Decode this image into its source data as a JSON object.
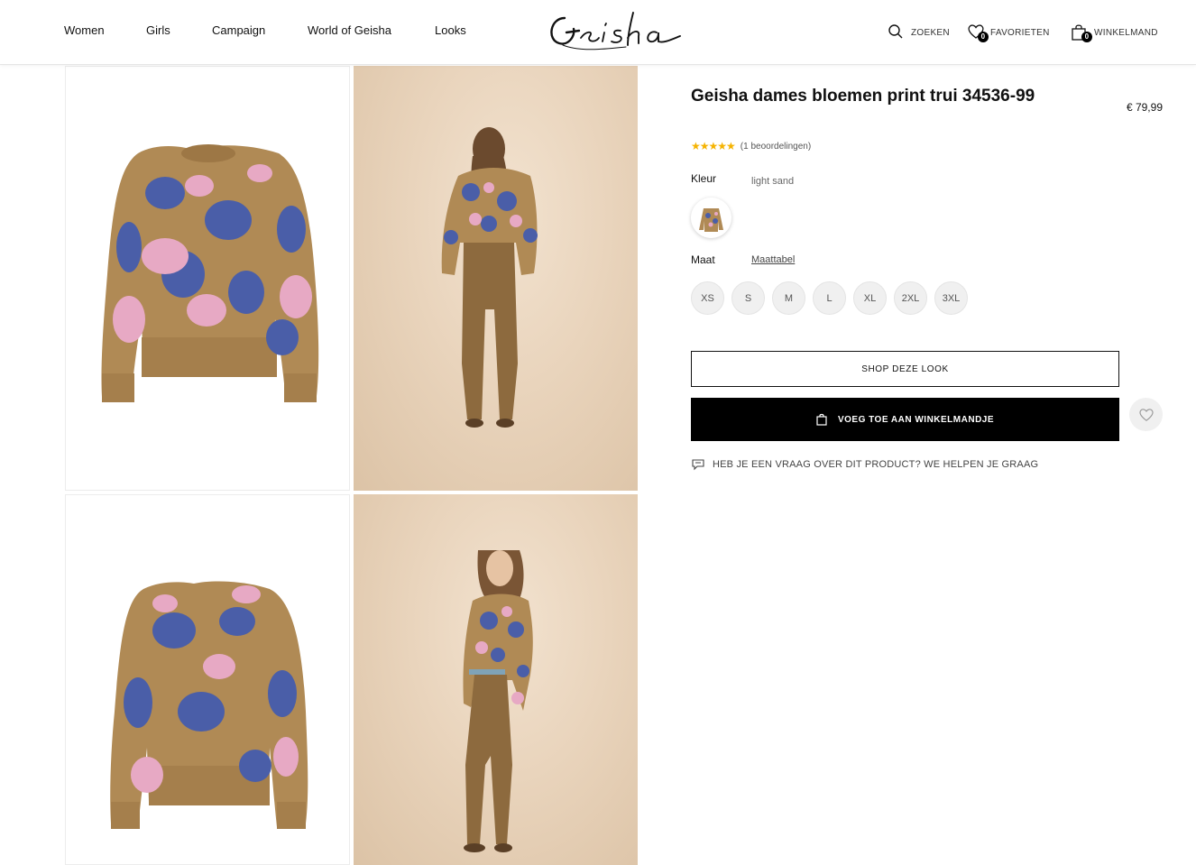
{
  "nav": {
    "women": "Women",
    "girls": "Girls",
    "campaign": "Campaign",
    "world": "World of Geisha",
    "looks": "Looks"
  },
  "brand": {
    "logo_text": "Geisha"
  },
  "header_actions": {
    "search": "ZOEKEN",
    "favorites": "FAVORIETEN",
    "favorites_count": "0",
    "cart": "WINKELMAND",
    "cart_count": "0"
  },
  "product": {
    "title": "Geisha dames bloemen print trui 34536-99",
    "price": "€ 79,99",
    "stars": "★★★★★",
    "rating_count": 5,
    "reviews": "(1 beoordelingen)",
    "color_label": "Kleur",
    "color_value": "light sand",
    "size_label": "Maat",
    "size_table": "Maattabel",
    "sizes": [
      "XS",
      "S",
      "M",
      "L",
      "XL",
      "2XL",
      "3XL"
    ],
    "shop_look": "SHOP DEZE LOOK",
    "add_to_cart": "VOEG TOE AAN WINKELMANDJE",
    "question": "HEB JE EEN VRAAG OVER DIT PRODUCT? WE HELPEN JE GRAAG"
  },
  "colors": {
    "accent": "#000000",
    "star": "#f5b301",
    "sweater_base": "#b08a55",
    "flower_blue": "#4a5ea8",
    "flower_pink": "#e7a9c4",
    "photo_bg": "#e9d4bc"
  }
}
